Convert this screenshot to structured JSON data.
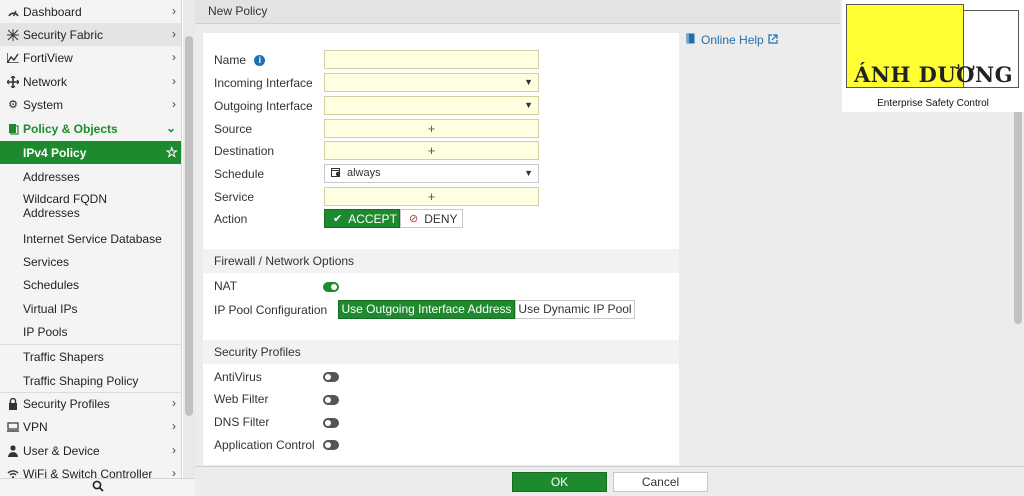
{
  "sidebar": {
    "items": [
      {
        "label": "Dashboard",
        "icon": "dashboard-icon"
      },
      {
        "label": "Security Fabric",
        "icon": "fabric-icon"
      },
      {
        "label": "FortiView",
        "icon": "chart-icon"
      },
      {
        "label": "Network",
        "icon": "network-icon"
      },
      {
        "label": "System",
        "icon": "gear-icon"
      },
      {
        "label": "Policy & Objects",
        "icon": "policy-icon"
      },
      {
        "label": "IPv4 Policy"
      },
      {
        "label": "Addresses"
      },
      {
        "label": "Wildcard FQDN Addresses"
      },
      {
        "label": "Internet Service Database"
      },
      {
        "label": "Services"
      },
      {
        "label": "Schedules"
      },
      {
        "label": "Virtual IPs"
      },
      {
        "label": "IP Pools"
      },
      {
        "label": "Traffic Shapers"
      },
      {
        "label": "Traffic Shaping Policy"
      },
      {
        "label": "Security Profiles",
        "icon": "lock-icon"
      },
      {
        "label": "VPN",
        "icon": "monitor-icon"
      },
      {
        "label": "User & Device",
        "icon": "user-icon"
      },
      {
        "label": "WiFi & Switch Controller",
        "icon": "wifi-icon"
      }
    ],
    "search_icon": "search-icon"
  },
  "header": {
    "title": "New Policy"
  },
  "form": {
    "name_label": "Name",
    "incoming_label": "Incoming Interface",
    "outgoing_label": "Outgoing Interface",
    "source_label": "Source",
    "destination_label": "Destination",
    "schedule_label": "Schedule",
    "schedule_value": "always",
    "service_label": "Service",
    "action_label": "Action",
    "accept_label": "ACCEPT",
    "deny_label": "DENY",
    "plus_glyph": "+"
  },
  "firewall": {
    "section_title": "Firewall / Network Options",
    "nat_label": "NAT",
    "nat_on": true,
    "ippool_label": "IP Pool Configuration",
    "ippool_option_1": "Use Outgoing Interface Address",
    "ippool_option_2": "Use Dynamic IP Pool"
  },
  "security": {
    "section_title": "Security Profiles",
    "profiles": [
      {
        "label": "AntiVirus",
        "on": false
      },
      {
        "label": "Web Filter",
        "on": false
      },
      {
        "label": "DNS Filter",
        "on": false
      },
      {
        "label": "Application Control",
        "on": false
      }
    ]
  },
  "help": {
    "label": "Online Help"
  },
  "footer": {
    "ok_label": "OK",
    "cancel_label": "Cancel"
  },
  "logo": {
    "brand": "ÁNH DƯƠNG",
    "tagline": "Enterprise Safety Control"
  },
  "colors": {
    "accent": "#1e8a2e",
    "field_bg": "#fffee0",
    "link": "#1f6fb3",
    "logo_yellow": "#ffff33"
  }
}
